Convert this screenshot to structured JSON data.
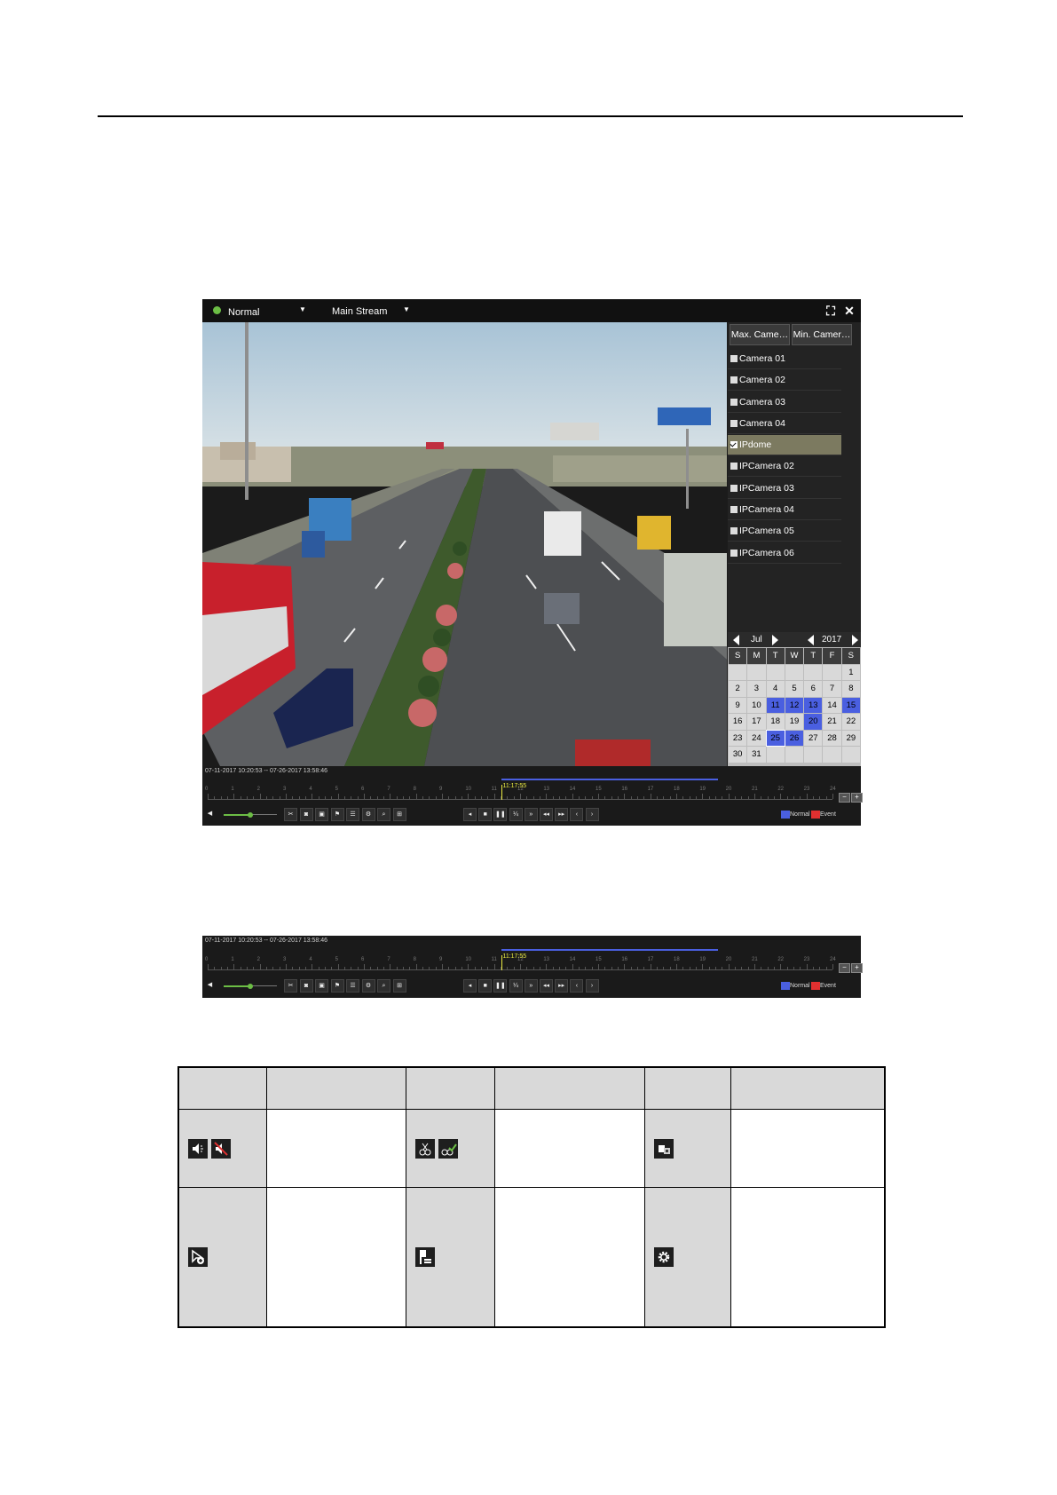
{
  "player": {
    "mode": "Normal",
    "stream": "Main Stream",
    "fullscreen_icon": "fullscreen-icon",
    "close_icon": "close-icon",
    "max_camera_btn": "Max. Came…",
    "min_camera_btn": "Min. Camer…",
    "cameras": [
      {
        "label": "Camera 01",
        "checked": false
      },
      {
        "label": "Camera 02",
        "checked": false
      },
      {
        "label": "Camera 03",
        "checked": false
      },
      {
        "label": "Camera 04",
        "checked": false
      },
      {
        "label": "IPdome",
        "checked": true
      },
      {
        "label": "IPCamera 02",
        "checked": false
      },
      {
        "label": "IPCamera 03",
        "checked": false
      },
      {
        "label": "IPCamera 04",
        "checked": false
      },
      {
        "label": "IPCamera 05",
        "checked": false
      },
      {
        "label": "IPCamera 06",
        "checked": false
      }
    ],
    "calendar": {
      "month": "Jul",
      "year": "2017",
      "weekdays": [
        "S",
        "M",
        "T",
        "W",
        "T",
        "F",
        "S"
      ],
      "days": [
        "",
        "",
        "",
        "",
        "",
        "",
        "1",
        "2",
        "3",
        "4",
        "5",
        "6",
        "7",
        "8",
        "9",
        "10",
        "11",
        "12",
        "13",
        "14",
        "15",
        "16",
        "17",
        "18",
        "19",
        "20",
        "21",
        "22",
        "23",
        "24",
        "25",
        "26",
        "27",
        "28",
        "29",
        "30",
        "31",
        "",
        "",
        "",
        "",
        ""
      ],
      "recorded_days": [
        "11",
        "12",
        "13",
        "15",
        "20",
        "25",
        "26"
      ],
      "selected_day": "25",
      "record_color": "#4a5fe0"
    },
    "timeline": {
      "range": "07-11-2017 10:20:53 -- 07-26-2017 13:58:46",
      "current_time": "11:17:55",
      "hours": [
        "0",
        "1",
        "2",
        "3",
        "4",
        "5",
        "6",
        "7",
        "8",
        "9",
        "10",
        "11",
        "12",
        "13",
        "14",
        "15",
        "16",
        "17",
        "18",
        "19",
        "20",
        "21",
        "22",
        "23",
        "24"
      ],
      "record_start_hour": 11.3,
      "record_end_hour": 19.6,
      "cursor_hour": 11.3,
      "legend_normal": "Normal",
      "legend_event": "Event",
      "normal_color": "#4a5fe0",
      "event_color": "#e03030",
      "volume_level": 0.5
    }
  },
  "strip": {
    "range": "07-11-2017 10:20:53 -- 07-26-2017 13:58:46",
    "current_time": "11:17:55",
    "legend_normal": "Normal",
    "legend_event": "Event"
  },
  "icon_table": {
    "row1": [
      "audio-on-off-icons",
      "clip-start-end-icons",
      "capture-picture-icon"
    ],
    "row2": [
      "add-tag-icon",
      "lock-file-icon",
      "settings-icon"
    ]
  }
}
